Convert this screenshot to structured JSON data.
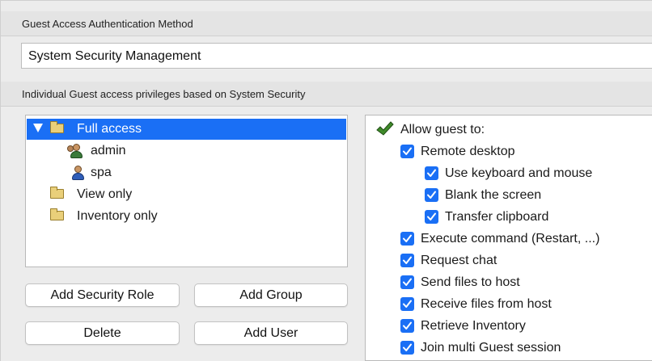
{
  "auth_section": {
    "header": "Guest Access Authentication Method",
    "selected_method": "System Security Management"
  },
  "privileges_section": {
    "header": "Individual Guest access privileges based on System Security"
  },
  "tree": {
    "full_access": "Full access",
    "admin": "admin",
    "spa": "spa",
    "view_only": "View only",
    "inventory_only": "Inventory only"
  },
  "buttons": {
    "add_security_role": "Add Security Role",
    "add_group": "Add Group",
    "delete": "Delete",
    "add_user": "Add User"
  },
  "permissions": {
    "allow_guest": "Allow guest to:",
    "remote_desktop": "Remote desktop",
    "use_keyboard_mouse": "Use keyboard and mouse",
    "blank_screen": "Blank the screen",
    "transfer_clipboard": "Transfer clipboard",
    "execute_command": "Execute command (Restart, ...)",
    "request_chat": "Request chat",
    "send_files": "Send files to host",
    "receive_files": "Receive files from host",
    "retrieve_inventory": "Retrieve Inventory",
    "join_multi_guest": "Join multi Guest session"
  },
  "colors": {
    "accent": "#1a6ff5",
    "check_green": "#3f8a2a"
  }
}
